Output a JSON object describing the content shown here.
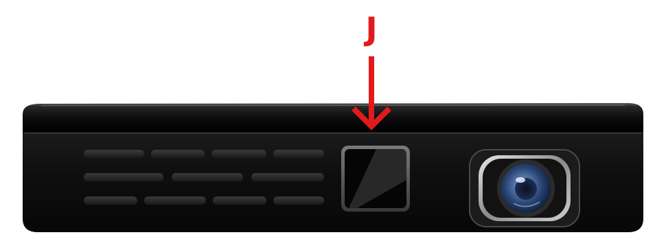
{
  "callout": {
    "label": "J",
    "color": "#e01b1b"
  },
  "device": {
    "body_color": "#0d0d0d",
    "vent_slot_color": "#2a2a2a",
    "lens_color": "#3d5f92"
  }
}
